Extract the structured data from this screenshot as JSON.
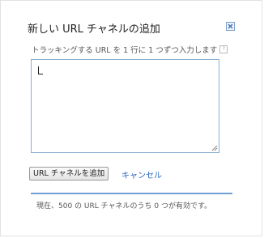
{
  "dialog": {
    "title": "新しい URL チャネルの追加",
    "close_icon": "close-icon",
    "instruction": "トラッキングする URL を 1 行に 1 つずつ入力します",
    "help_icon": "help-icon",
    "help_glyph": "?",
    "textarea_value": "",
    "add_button_label": "URL チャネルを追加",
    "cancel_label": "キャンセル",
    "status_text": "現在、500 の URL チャネルのうち 0 つが有効です。"
  },
  "colors": {
    "accent": "#2a66c2",
    "divider": "#6e9fd4",
    "textarea_border": "#8aaed2"
  }
}
